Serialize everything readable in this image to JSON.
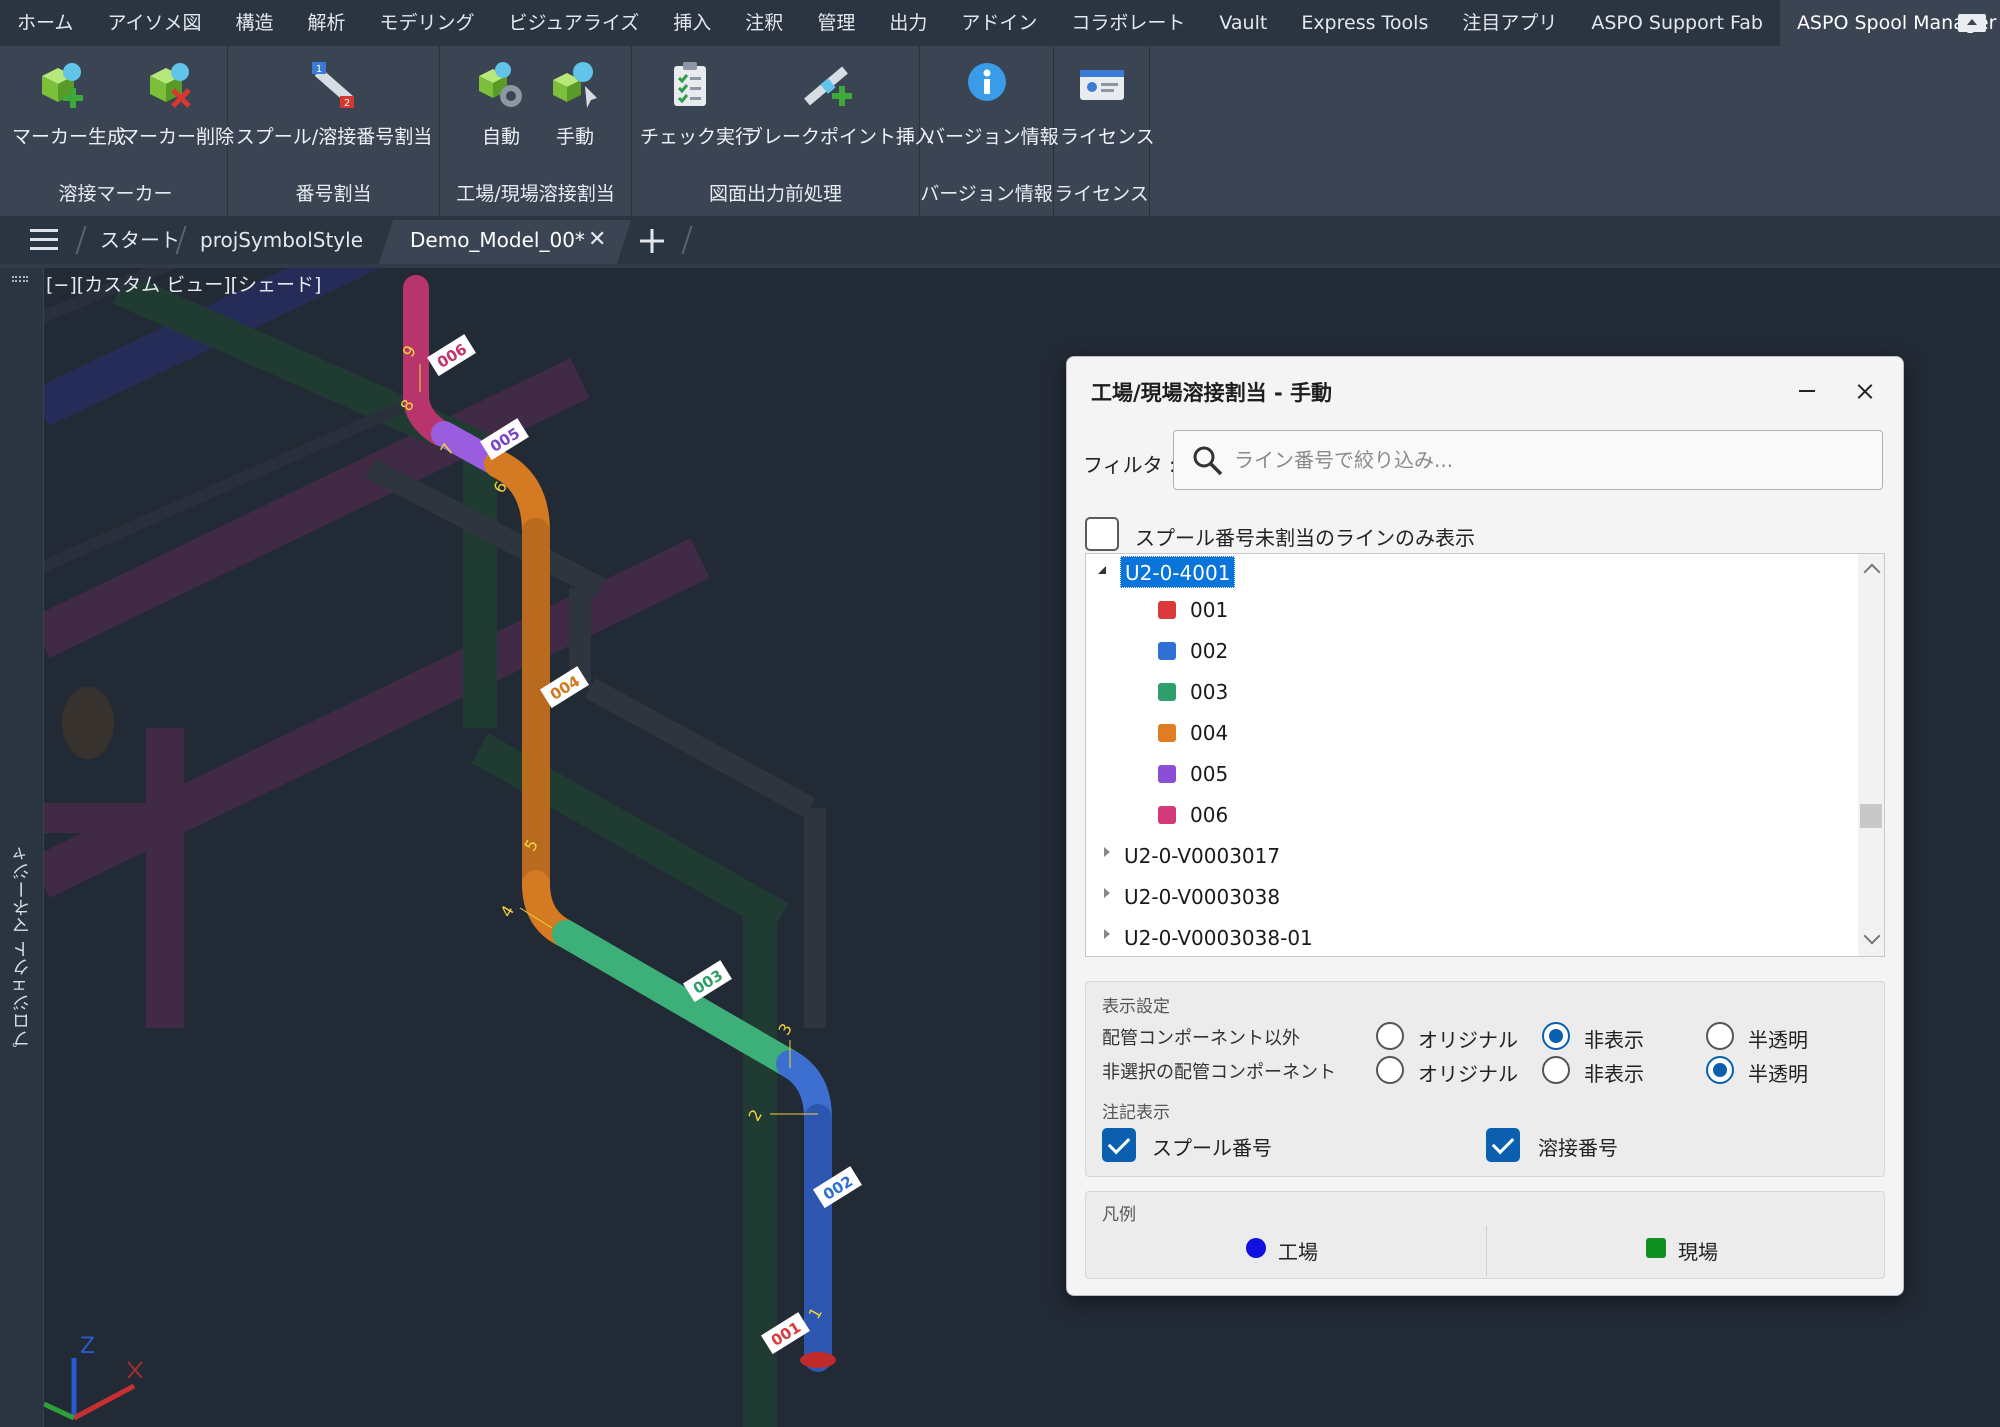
{
  "ribbon": {
    "tabs": [
      "ホーム",
      "アイソメ図",
      "構造",
      "解析",
      "モデリング",
      "ビジュアライズ",
      "挿入",
      "注釈",
      "管理",
      "出力",
      "アドイン",
      "コラボレート",
      "Vault",
      "Express Tools",
      "注目アプリ",
      "ASPO Support Fab",
      "ASPO Spool Manager"
    ],
    "active_tab": "ASPO Spool Manager",
    "groups": {
      "weld_marker": {
        "title": "溶接マーカー",
        "create": "マーカー生成",
        "delete": "マーカー削除"
      },
      "numbering": {
        "title": "番号割当",
        "assign": "スプール/溶接番号割当"
      },
      "shop_field": {
        "title": "工場/現場溶接割当",
        "auto": "自動",
        "manual": "手動"
      },
      "preprocess": {
        "title": "図面出力前処理",
        "check": "チェック実行",
        "breakpoint": "ブレークポイント挿入"
      },
      "version": {
        "title": "バージョン情報",
        "info": "バージョン情報"
      },
      "license": {
        "title": "ライセンス",
        "license": "ライセンス"
      }
    }
  },
  "doc_tabs": {
    "start": "スタート",
    "style": "projSymbolStyle",
    "active": "Demo_Model_00*"
  },
  "viewport": {
    "label": "[−][カスタム ビュー][シェード]",
    "side_panel": "プロジェクト マネージャ",
    "spool_tags": [
      "006",
      "005",
      "004",
      "003",
      "002",
      "001"
    ],
    "weld_numbers": [
      "9",
      "8",
      "7",
      "6",
      "5",
      "4",
      "3",
      "2",
      "1"
    ],
    "axis_z": "Z"
  },
  "dialog": {
    "title": "工場/現場溶接割当 - 手動",
    "filter_label": "フィルタ :",
    "filter_placeholder": "ライン番号で絞り込み...",
    "filter_value": "",
    "only_unassigned_label": "スプール番号未割当のラインのみ表示",
    "only_unassigned": false,
    "tree": {
      "root": "U2-0-4001",
      "children": [
        {
          "label": "001",
          "color": "#d93a3a"
        },
        {
          "label": "002",
          "color": "#2f6fd6"
        },
        {
          "label": "003",
          "color": "#2e9e6a"
        },
        {
          "label": "004",
          "color": "#e07c22"
        },
        {
          "label": "005",
          "color": "#8a4fd6"
        },
        {
          "label": "006",
          "color": "#d23a7a"
        }
      ],
      "collapsed": [
        "U2-0-V0003017",
        "U2-0-V0003038",
        "U2-0-V0003038-01"
      ]
    },
    "display": {
      "section_label": "表示設定",
      "rows": [
        {
          "label": "配管コンポーネント以外",
          "selected": "非表示"
        },
        {
          "label": "非選択の配管コンポーネント",
          "selected": "半透明"
        }
      ],
      "options": [
        "オリジナル",
        "非表示",
        "半透明"
      ],
      "annotation_label": "注記表示",
      "spool_number_label": "スプール番号",
      "spool_number_checked": true,
      "weld_number_label": "溶接番号",
      "weld_number_checked": true
    },
    "legend": {
      "label": "凡例",
      "shop": {
        "label": "工場",
        "color": "#1010e0"
      },
      "field": {
        "label": "現場",
        "color": "#0f8f1f"
      }
    }
  }
}
